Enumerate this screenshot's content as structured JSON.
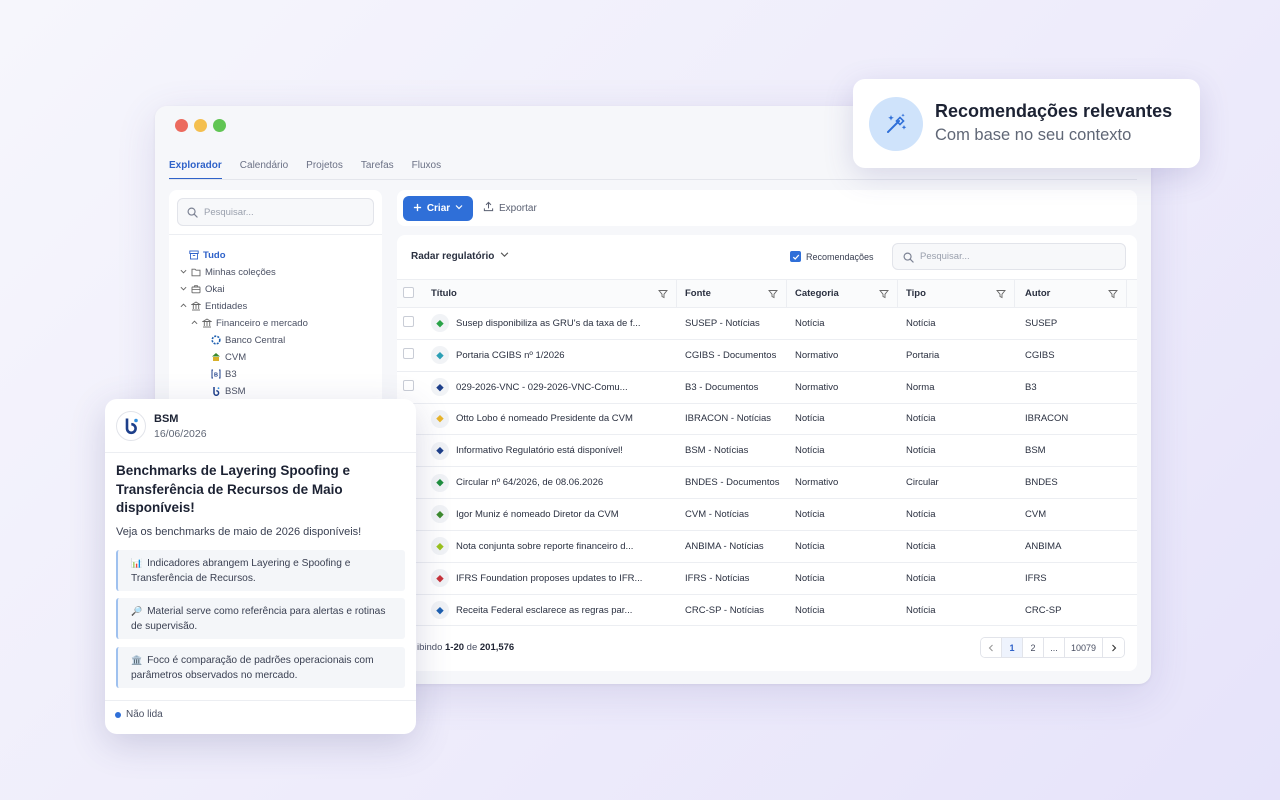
{
  "tabs": [
    {
      "label": "Explorador",
      "active": true
    },
    {
      "label": "Calendário"
    },
    {
      "label": "Projetos"
    },
    {
      "label": "Tarefas"
    },
    {
      "label": "Fluxos"
    }
  ],
  "sidebar": {
    "search_placeholder": "Pesquisar...",
    "tree": [
      {
        "label": "Tudo",
        "active": true,
        "icon": "archive-icon"
      },
      {
        "label": "Minhas coleções",
        "icon": "folder-icon"
      },
      {
        "label": "Okai",
        "icon": "briefcase-icon"
      },
      {
        "label": "Entidades",
        "icon": "bank-icon"
      },
      {
        "label": "Financeiro e mercado",
        "icon": "bank-icon"
      },
      {
        "label": "Banco Central",
        "icon": "banco-central-logo-icon"
      },
      {
        "label": "CVM",
        "icon": "cvm-logo-icon"
      },
      {
        "label": "B3",
        "icon": "b3-logo-icon"
      },
      {
        "label": "BSM",
        "icon": "bsm-logo-icon"
      }
    ]
  },
  "toolbar": {
    "create_label": "Criar",
    "export_label": "Exportar"
  },
  "main": {
    "view_label": "Radar regulatório",
    "recommendations_label": "Recomendações",
    "recommendations_checked": true,
    "search_placeholder": "Pesquisar...",
    "columns": [
      "Título",
      "Fonte",
      "Categoria",
      "Tipo",
      "Autor"
    ],
    "rows": [
      {
        "title": "Susep disponibiliza as GRU's da taxa de f...",
        "source": "SUSEP - Notícias",
        "category": "Notícia",
        "type": "Notícia",
        "author": "SUSEP",
        "icon": "susep-logo-icon",
        "color": "#2aa348"
      },
      {
        "title": "Portaria CGIBS nº 1/2026",
        "source": "CGIBS - Documentos",
        "category": "Normativo",
        "type": "Portaria",
        "author": "CGIBS",
        "icon": "cgibs-logo-icon",
        "color": "#2c9fb5"
      },
      {
        "title": "029-2026-VNC - 029-2026-VNC-Comu...",
        "source": "B3 - Documentos",
        "category": "Normativo",
        "type": "Norma",
        "author": "B3",
        "icon": "b3-logo-icon",
        "color": "#1d3f8a"
      },
      {
        "title": "Otto Lobo é nomeado Presidente da CVM",
        "source": "IBRACON - Notícias",
        "category": "Notícia",
        "type": "Notícia",
        "author": "IBRACON",
        "icon": "ibracon-logo-icon",
        "color": "#e9b52a"
      },
      {
        "title": "Informativo Regulatório está disponível!",
        "source": "BSM - Notícias",
        "category": "Notícia",
        "type": "Notícia",
        "author": "BSM",
        "icon": "bsm-logo-icon",
        "color": "#1d3f8a"
      },
      {
        "title": "Circular nº 64/2026, de 08.06.2026",
        "source": "BNDES - Documentos",
        "category": "Normativo",
        "type": "Circular",
        "author": "BNDES",
        "icon": "bndes-logo-icon",
        "color": "#1f8f3f"
      },
      {
        "title": "Igor Muniz é nomeado Diretor da CVM",
        "source": "CVM - Notícias",
        "category": "Notícia",
        "type": "Notícia",
        "author": "CVM",
        "icon": "cvm-logo-icon",
        "color": "#3c8a2e"
      },
      {
        "title": "Nota conjunta sobre reporte financeiro d...",
        "source": "ANBIMA - Notícias",
        "category": "Notícia",
        "type": "Notícia",
        "author": "ANBIMA",
        "icon": "anbima-logo-icon",
        "color": "#9ac21d"
      },
      {
        "title": "IFRS Foundation proposes updates to IFR...",
        "source": "IFRS - Notícias",
        "category": "Notícia",
        "type": "Notícia",
        "author": "IFRS",
        "icon": "ifrs-logo-icon",
        "color": "#c8323a"
      },
      {
        "title": "Receita Federal esclarece as regras par...",
        "source": "CRC-SP - Notícias",
        "category": "Notícia",
        "type": "Notícia",
        "author": "CRC-SP",
        "icon": "crcsp-logo-icon",
        "color": "#1d5fb0"
      }
    ],
    "footer": {
      "prefix": "ibindo",
      "range": "1-20",
      "of": "de",
      "total": "201,576",
      "pages": [
        "1",
        "2",
        "...",
        "10079"
      ],
      "current_page": "1"
    }
  },
  "badge": {
    "title": "Recomendações relevantes",
    "subtitle": "Com base no seu contexto",
    "icon": "magic-wand-icon"
  },
  "card": {
    "source": "BSM",
    "date": "16/06/2026",
    "title": "Benchmarks de Layering Spoofing e Transferência de Recursos de Maio disponíveis!",
    "description": "Veja os benchmarks de maio de 2026 disponíveis!",
    "bullets": [
      {
        "emoji": "📊",
        "text": "Indicadores abrangem Layering e Spoofing e Transferência de Recursos."
      },
      {
        "emoji": "🔎",
        "text": "Material serve como referência para alertas e rotinas de supervisão."
      },
      {
        "emoji": "🏛️",
        "text": "Foco é comparação de padrões operacionais com parâmetros observados no mercado."
      }
    ],
    "status": "Não lida"
  },
  "colors": {
    "accent": "#2f6fd8",
    "active_tab": "#2f62c9",
    "badge_icon_bg": "#cfe3fb"
  }
}
